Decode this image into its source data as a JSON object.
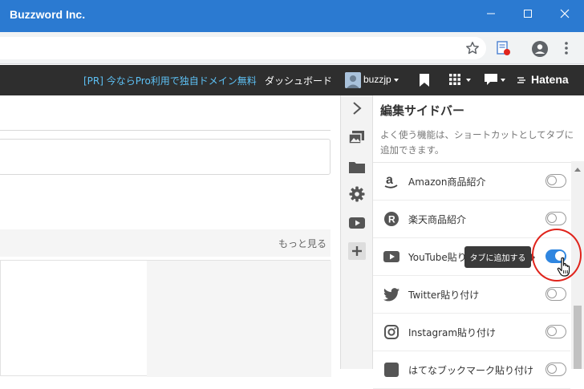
{
  "window": {
    "title": "Buzzword Inc."
  },
  "hatena_bar": {
    "promo": "[PR] 今ならPro利用で独自ドメイン無料",
    "dashboard": "ダッシュボード",
    "username": "buzzjp",
    "logo": "Hatena"
  },
  "editor": {
    "more_link": "もっと見る"
  },
  "sidebar": {
    "title": "編集サイドバー",
    "description": "よく使う機能は、ショートカットとしてタブに追加できます。",
    "items": [
      {
        "label": "Amazon商品紹介",
        "icon": "amazon-icon",
        "enabled": false
      },
      {
        "label": "楽天商品紹介",
        "icon": "rakuten-icon",
        "enabled": false
      },
      {
        "label": "YouTube貼り",
        "icon": "youtube-icon",
        "enabled": true
      },
      {
        "label": "Twitter貼り付け",
        "icon": "twitter-icon",
        "enabled": false
      },
      {
        "label": "Instagram貼り付け",
        "icon": "instagram-icon",
        "enabled": false
      },
      {
        "label": "はてなブックマーク貼り付け",
        "icon": "hatena-bookmark-icon",
        "enabled": false
      }
    ],
    "tooltip": "タブに追加する"
  },
  "colors": {
    "titlebar": "#2b7ad1",
    "hatena_bar": "#2e2e2e",
    "promo_text": "#5dc1f5",
    "toggle_on": "#2f86e0",
    "highlight_circle": "#e0241c"
  }
}
